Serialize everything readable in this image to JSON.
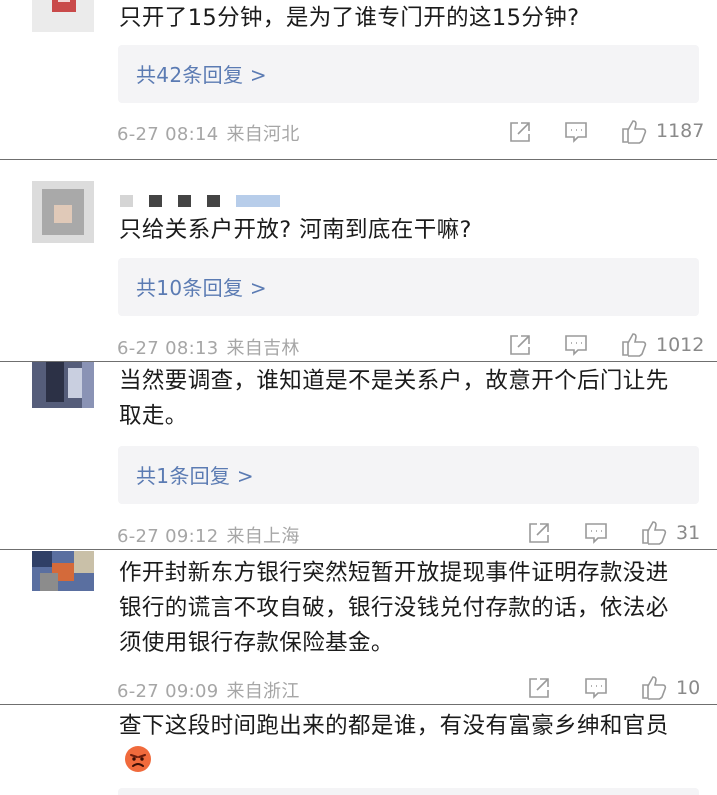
{
  "comments": [
    {
      "text": "只开了15分钟，是为了谁专门开的这15分钟?",
      "replies": "共42条回复 >",
      "time": "6-27 08:14",
      "location": "来自河北",
      "likes": "1187"
    },
    {
      "text": "只给关系户开放? 河南到底在干嘛?",
      "replies": "共10条回复 >",
      "time": "6-27 08:13",
      "location": "来自吉林",
      "likes": "1012"
    },
    {
      "text": "当然要调查，谁知道是不是关系户，故意开个后门让先取走。",
      "replies": "共1条回复 >",
      "time": "6-27 09:12",
      "location": "来自上海",
      "likes": "31"
    },
    {
      "text": "作开封新东方银行突然短暂开放提现事件证明存款没进银行的谎言不攻自破，银行没钱兑付存款的话，依法必须使用银行存款保险基金。",
      "time": "6-27 09:09",
      "location": "来自浙江",
      "likes": "10"
    },
    {
      "text": "查下这段时间跑出来的都是谁，有没有富豪乡绅和官员",
      "emoji": "angry-face-emoji"
    }
  ]
}
